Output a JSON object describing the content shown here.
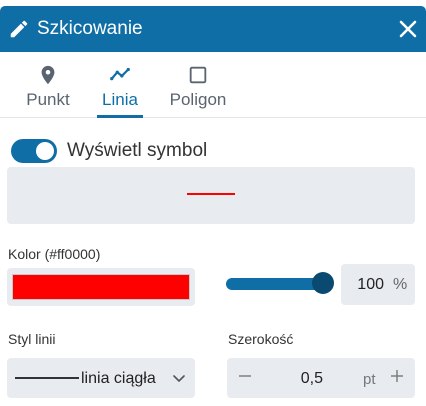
{
  "header": {
    "title": "Szkicowanie",
    "icon": "pencil-icon",
    "close_icon": "close-icon"
  },
  "tabs": [
    {
      "label": "Punkt",
      "icon": "map-pin-icon",
      "active": false
    },
    {
      "label": "Linia",
      "icon": "polyline-icon",
      "active": true
    },
    {
      "label": "Poligon",
      "icon": "square-icon",
      "active": false
    }
  ],
  "symbol_toggle": {
    "label": "Wyświetl symbol",
    "on": true
  },
  "preview": {
    "stroke_color": "#ff0000"
  },
  "color": {
    "label": "Kolor (#ff0000)",
    "value": "#ff0000"
  },
  "opacity": {
    "value": "100",
    "unit": "%",
    "level": 1.0
  },
  "line_style": {
    "label": "Styl linii",
    "value": "linia ciągła"
  },
  "width": {
    "label": "Szerokość",
    "value": "0,5",
    "unit": "pt",
    "minus": "−",
    "plus": "+"
  },
  "colors": {
    "accent": "#0f6ea6",
    "panel": "#e8ebf0",
    "slider_thumb": "#0b4a70"
  }
}
